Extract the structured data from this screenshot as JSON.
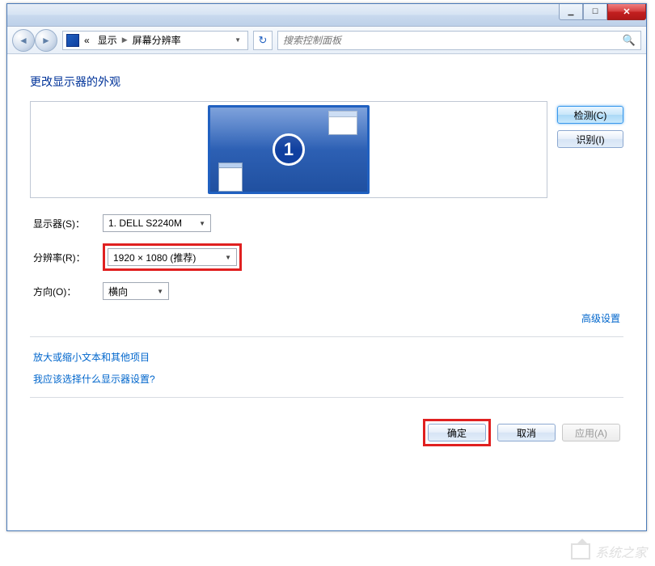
{
  "titlebar": {
    "min_symbol": "▁",
    "max_symbol": "☐",
    "close_symbol": "✕"
  },
  "nav": {
    "back_symbol": "◄",
    "fwd_symbol": "►",
    "bc_back": "«",
    "bc_display": "显示",
    "bc_sep": "▶",
    "bc_current": "屏幕分辨率",
    "bc_drop": "▼",
    "refresh_symbol": "↻",
    "search_placeholder": "搜索控制面板",
    "search_icon": "🔍"
  },
  "main": {
    "heading": "更改显示器的外观",
    "monitor_number": "1",
    "detect_btn": "检测(C)",
    "identify_btn": "识别(I)",
    "labels": {
      "monitor": "显示器(S)：",
      "resolution": "分辨率(R)：",
      "orientation": "方向(O)："
    },
    "values": {
      "monitor": "1. DELL S2240M",
      "resolution": "1920 × 1080 (推荐)",
      "orientation": "横向"
    },
    "advanced_link": "高级设置",
    "help1": "放大或缩小文本和其他项目",
    "help2": "我应该选择什么显示器设置?",
    "ok_btn": "确定",
    "cancel_btn": "取消",
    "apply_btn": "应用(A)"
  },
  "watermark": "系统之家"
}
